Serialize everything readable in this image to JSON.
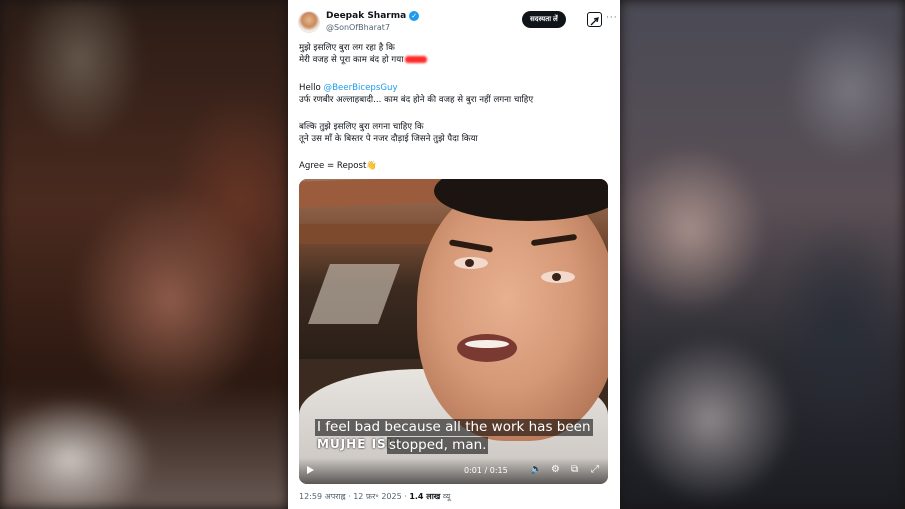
{
  "tweet": {
    "author_name": "Deepak Sharma",
    "author_handle": "@SonOfBharat7",
    "subscribe_label": "सदस्यता लें",
    "more_label": "···",
    "lines": {
      "l1": "मुझे इसलिए बुरा लग रहा है कि",
      "l2": "मेरी वजह से पूरा काम बंद हो गया",
      "hello": "Hello ",
      "mention": "@BeerBicepsGuy",
      "l3": "उर्फ रणबीर अल्लाहबादी... काम बंद होने की वजह से बुरा नहीं लगना चाहिए",
      "l4": "बल्कि तुझे इसलिए बुरा लगना चाहिए कि",
      "l5": "तूने उस माँ के बिस्तर पे नजर दौड़ाई जिसने तुझे पैदा किया",
      "l6": "Agree = Repost👋"
    },
    "video": {
      "subtitle_line1": "I feel bad because all the work has been",
      "subtitle_line2": "stopped, man.",
      "burned_caption": "MUJHE ISLI",
      "time": "0:01 / 0:15"
    },
    "meta": {
      "time_date": "12:59 अपराह्न · 12 फ़र॰ 2025 · ",
      "views_count": "1.4 लाख",
      "views_label": " व्यू"
    }
  },
  "icons": {
    "verified": "verified-badge-icon",
    "grok": "grok-icon",
    "play": "play-icon",
    "volume": "volume-icon",
    "settings": "settings-icon",
    "pip": "picture-in-picture-icon",
    "fullscreen": "fullscreen-icon"
  },
  "colors": {
    "accent": "#1d9bf0",
    "text": "#0f1419",
    "muted": "#536471"
  }
}
